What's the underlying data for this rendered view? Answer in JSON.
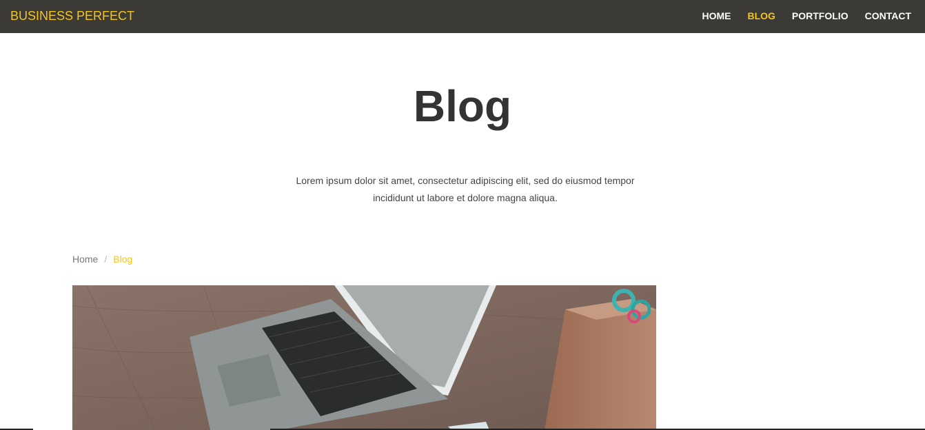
{
  "navbar": {
    "brand": "BUSINESS PERFECT",
    "links": [
      {
        "label": "HOME",
        "active": false
      },
      {
        "label": "BLOG",
        "active": true
      },
      {
        "label": "PORTFOLIO",
        "active": false
      },
      {
        "label": "CONTACT",
        "active": false
      }
    ]
  },
  "hero": {
    "title": "Blog",
    "subtitle_line1": "Lorem ipsum dolor sit amet, consectetur adipiscing elit, sed do eiusmod tempor",
    "subtitle_line2": "incididunt ut labore et dolore magna aliqua."
  },
  "breadcrumb": {
    "home": "Home",
    "separator": "/",
    "current": "Blog"
  },
  "post": {
    "image_subject": "laptop-on-wooden-desk"
  },
  "colors": {
    "navbar_bg": "#3b3a36",
    "accent": "#f5c518",
    "heading": "#333333"
  }
}
